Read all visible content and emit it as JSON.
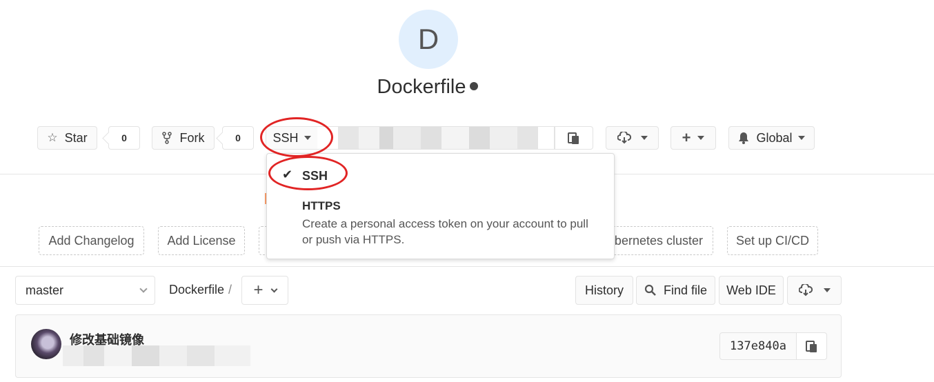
{
  "project": {
    "avatar_letter": "D",
    "name": "Dockerfile",
    "visibility_icon": "globe-icon"
  },
  "actions": {
    "star_label": "Star",
    "star_count": "0",
    "fork_label": "Fork",
    "fork_count": "0",
    "protocol_selected": "SSH",
    "notification_label": "Global"
  },
  "clone_dropdown": {
    "options": [
      {
        "label": "SSH",
        "checked": true,
        "description": ""
      },
      {
        "label": "HTTPS",
        "checked": false,
        "description": "Create a personal access token on your account to pull or push via HTTPS."
      }
    ]
  },
  "quick_actions": {
    "add_changelog": "Add Changelog",
    "add_license": "Add License",
    "kubernetes": "ubernetes cluster",
    "setup_ci": "Set up CI/CD"
  },
  "repo_nav": {
    "branch": "master",
    "breadcrumb_root": "Dockerfile",
    "breadcrumb_sep": "/",
    "history": "History",
    "find_file": "Find file",
    "web_ide": "Web IDE"
  },
  "last_commit": {
    "title": "修改基础镜像",
    "sha": "137e840a"
  },
  "colors": {
    "annotation_ring": "#e12424",
    "avatar_bg": "#e1effd"
  }
}
